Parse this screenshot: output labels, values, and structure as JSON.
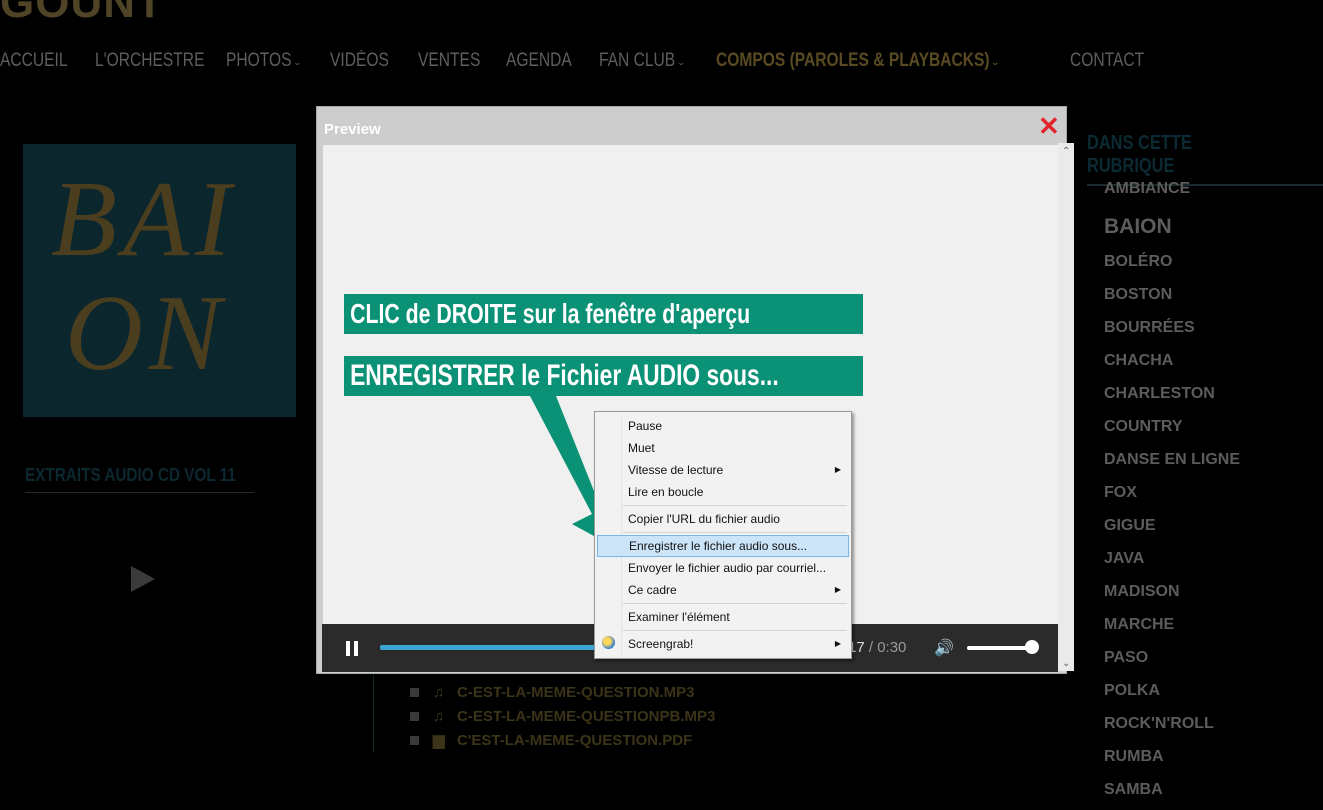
{
  "site": {
    "logo_text": "GOUNT"
  },
  "nav": {
    "items": [
      {
        "label": "ACCUEIL"
      },
      {
        "label": "L'ORCHESTRE"
      },
      {
        "label": "PHOTOS"
      },
      {
        "label": "VIDÉOS"
      },
      {
        "label": "VENTES"
      },
      {
        "label": "AGENDA"
      },
      {
        "label": "FAN CLUB"
      },
      {
        "label": "COMPOS (PAROLES & PLAYBACKS)"
      },
      {
        "label": "CONTACT"
      }
    ],
    "chevron": "⌄"
  },
  "album": {
    "line1": "BAI",
    "line2": "ON"
  },
  "left_section": {
    "title": "EXTRAITS AUDIO CD VOL 11"
  },
  "files": [
    {
      "name": "C-EST-LA-MEME-QUESTION.MP3",
      "icon": "♫"
    },
    {
      "name": "C-EST-LA-MEME-QUESTIONPB.MP3",
      "icon": "♫"
    },
    {
      "name": "C'EST-LA-MEME-QUESTION.PDF",
      "icon": "▆"
    }
  ],
  "right_section": {
    "title": "DANS CETTE RUBRIQUE",
    "items": [
      {
        "label": "AMBIANCE"
      },
      {
        "label": "BAION"
      },
      {
        "label": "BOLÉRO"
      },
      {
        "label": "BOSTON"
      },
      {
        "label": "BOURRÉES"
      },
      {
        "label": "CHACHA"
      },
      {
        "label": "CHARLESTON"
      },
      {
        "label": "COUNTRY"
      },
      {
        "label": "DANSE EN LIGNE"
      },
      {
        "label": "FOX"
      },
      {
        "label": "GIGUE"
      },
      {
        "label": "JAVA"
      },
      {
        "label": "MADISON"
      },
      {
        "label": "MARCHE"
      },
      {
        "label": "PASO"
      },
      {
        "label": "POLKA"
      },
      {
        "label": "ROCK'N'ROLL"
      },
      {
        "label": "RUMBA"
      },
      {
        "label": "SAMBA"
      }
    ]
  },
  "modal": {
    "title": "Preview",
    "close": "✕"
  },
  "banners": {
    "line1": "CLIC de DROITE sur la fenêtre d'aperçu",
    "line2": "ENREGISTRER le Fichier AUDIO sous..."
  },
  "player": {
    "current_time": "17",
    "separator": " / ",
    "total_time": "0:30",
    "volume_icon": "🔊"
  },
  "context_menu": {
    "items": [
      {
        "label": "Pause"
      },
      {
        "label": "Muet"
      },
      {
        "label": "Vitesse de lecture",
        "submenu": true
      },
      {
        "label": "Lire en boucle"
      },
      {
        "label": "Copier l'URL du fichier audio"
      },
      {
        "label": "Enregistrer le fichier audio sous...",
        "highlighted": true
      },
      {
        "label": "Envoyer le fichier audio par courriel..."
      },
      {
        "label": "Ce cadre",
        "submenu": true
      },
      {
        "label": "Examiner l'élément"
      },
      {
        "label": "Screengrab!",
        "submenu": true
      }
    ],
    "submenu_glyph": "▶"
  },
  "colors": {
    "accent_green": "#0b9276",
    "close_red": "#e3242b",
    "progress_blue": "#3aa6d8",
    "menu_highlight": "#cce4f7"
  }
}
